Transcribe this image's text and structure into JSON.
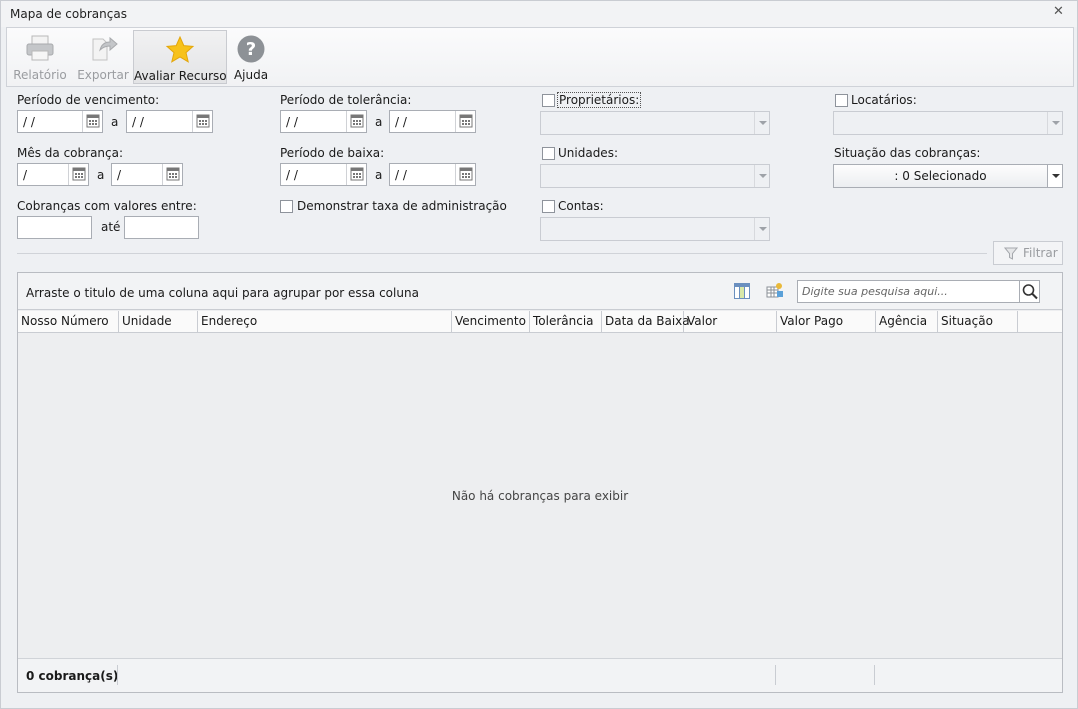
{
  "window": {
    "title": "Mapa de cobranças"
  },
  "ribbon": {
    "relatorio": "Relatório",
    "exportar": "Exportar",
    "avaliar": "Avaliar Recurso",
    "ajuda": "Ajuda"
  },
  "filters": {
    "periodo_vencimento": {
      "label": "Período de vencimento:",
      "from": "/ /",
      "sep": "a",
      "to": "/ /"
    },
    "periodo_tolerancia": {
      "label": "Período de tolerância:",
      "from": "/ /",
      "sep": "a",
      "to": "/ /"
    },
    "mes_cobranca": {
      "label": "Mês da cobrança:",
      "from": "/",
      "sep": "a",
      "to": "/"
    },
    "periodo_baixa": {
      "label": "Período de baixa:",
      "from": "/ /",
      "sep": "a",
      "to": "/ /"
    },
    "valores": {
      "label": "Cobranças com valores entre:",
      "sep": "até"
    },
    "demonstrar_taxa": "Demonstrar taxa de administração",
    "proprietarios": "Proprietários:",
    "unidades": "Unidades:",
    "contas": "Contas:",
    "locatarios": "Locatários:",
    "situacao": {
      "label": "Situação das cobranças:",
      "value": ": 0 Selecionado"
    },
    "filtrar": "Filtrar"
  },
  "grid": {
    "group_hint": "Arraste o titulo de uma coluna aqui para agrupar por essa coluna",
    "search_placeholder": "Digite sua pesquisa aqui...",
    "columns": [
      "Nosso Número",
      "Unidade",
      "Endereço",
      "Vencimento",
      "Tolerância",
      "Data da Baixa",
      "Valor",
      "Valor Pago",
      "Agência",
      "Situação"
    ],
    "empty_text": "Não há cobranças para exibir",
    "count": "0 cobrança(s)"
  }
}
